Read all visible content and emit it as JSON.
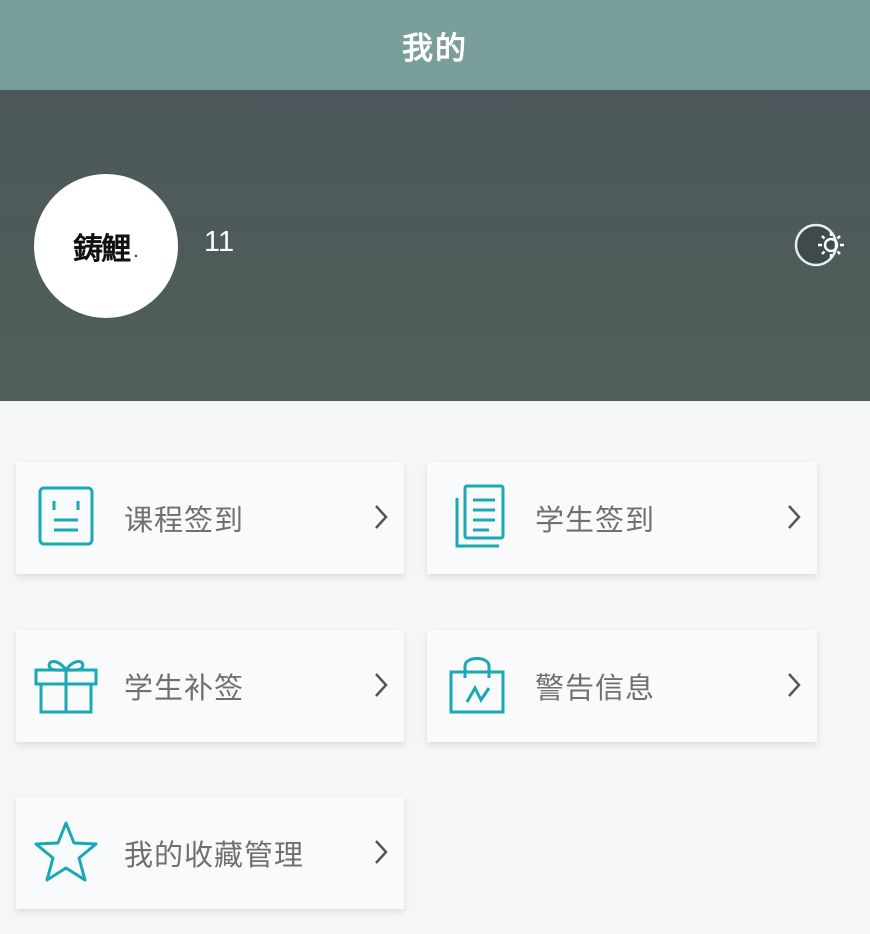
{
  "header": {
    "title": "我的"
  },
  "profile": {
    "avatar_text": "鋳鯉",
    "avatar_mark": ".",
    "username": "11"
  },
  "menu": [
    {
      "label": "课程签到",
      "icon": "sign-in-board-icon"
    },
    {
      "label": "学生签到",
      "icon": "document-stack-icon"
    },
    {
      "label": "学生补签",
      "icon": "gift-box-icon"
    },
    {
      "label": "警告信息",
      "icon": "shopping-bag-icon"
    },
    {
      "label": "我的收藏管理",
      "icon": "star-icon"
    }
  ],
  "colors": {
    "header_bg": "#7a9e9a",
    "profile_bg": "#4d575b",
    "icon_accent": "#1aa8b4",
    "label_text": "#707070"
  }
}
